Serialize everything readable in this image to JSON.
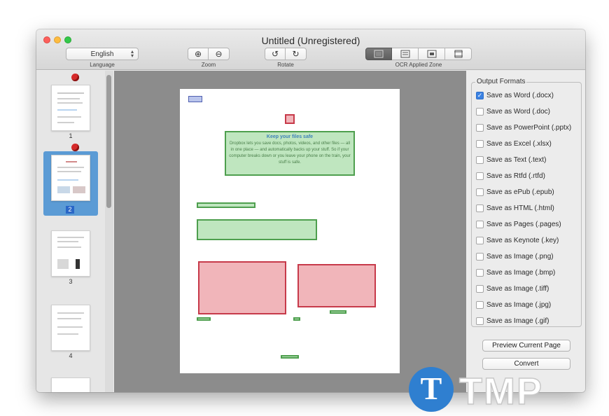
{
  "window": {
    "title": "Untitled (Unregistered)"
  },
  "toolbar": {
    "language_value": "English",
    "language_label": "Language",
    "zoom_label": "Zoom",
    "zoom_in_glyph": "⊕",
    "zoom_out_glyph": "⊖",
    "rotate_label": "Rotate",
    "rotate_left_glyph": "↺",
    "rotate_right_glyph": "↻",
    "ocr_zone_label": "OCR Applied Zone",
    "zone_icons": [
      "zone-all-icon",
      "zone-columns-icon",
      "zone-image-icon",
      "zone-table-icon"
    ]
  },
  "sidebar": {
    "pages": [
      {
        "number": "1",
        "pinned": true
      },
      {
        "number": "2",
        "pinned": true,
        "selected": true
      },
      {
        "number": "3",
        "pinned": false
      },
      {
        "number": "4",
        "pinned": false
      }
    ]
  },
  "document": {
    "header": "Keep your files safe",
    "body": "Dropbox lets you save docs, photos, videos, and other files — all in one place — and automatically backs up your stuff. So if your computer breaks down or you leave your phone on the train, your stuff is safe."
  },
  "output": {
    "group_title": "Output Formats",
    "formats": [
      {
        "label": "Save as Word (.docx)",
        "checked": true
      },
      {
        "label": "Save as Word (.doc)",
        "checked": false
      },
      {
        "label": "Save as PowerPoint (.pptx)",
        "checked": false
      },
      {
        "label": "Save as Excel (.xlsx)",
        "checked": false
      },
      {
        "label": "Save as Text (.text)",
        "checked": false
      },
      {
        "label": "Save as Rtfd (.rtfd)",
        "checked": false
      },
      {
        "label": "Save as ePub (.epub)",
        "checked": false
      },
      {
        "label": "Save as HTML (.html)",
        "checked": false
      },
      {
        "label": "Save as Pages (.pages)",
        "checked": false
      },
      {
        "label": "Save as Keynote (.key)",
        "checked": false
      },
      {
        "label": "Save as Image (.png)",
        "checked": false
      },
      {
        "label": "Save as Image (.bmp)",
        "checked": false
      },
      {
        "label": "Save as Image (.tiff)",
        "checked": false
      },
      {
        "label": "Save as Image (.jpg)",
        "checked": false
      },
      {
        "label": "Save as Image (.gif)",
        "checked": false
      }
    ],
    "preview_button": "Preview Current Page",
    "convert_button": "Convert"
  },
  "watermark": {
    "letter": "T",
    "text": "TMP"
  },
  "colors": {
    "selection": "#5b9bd5",
    "checkbox_checked": "#3b82e2",
    "zone_text": "#8ad28a",
    "zone_image": "#e67882"
  }
}
